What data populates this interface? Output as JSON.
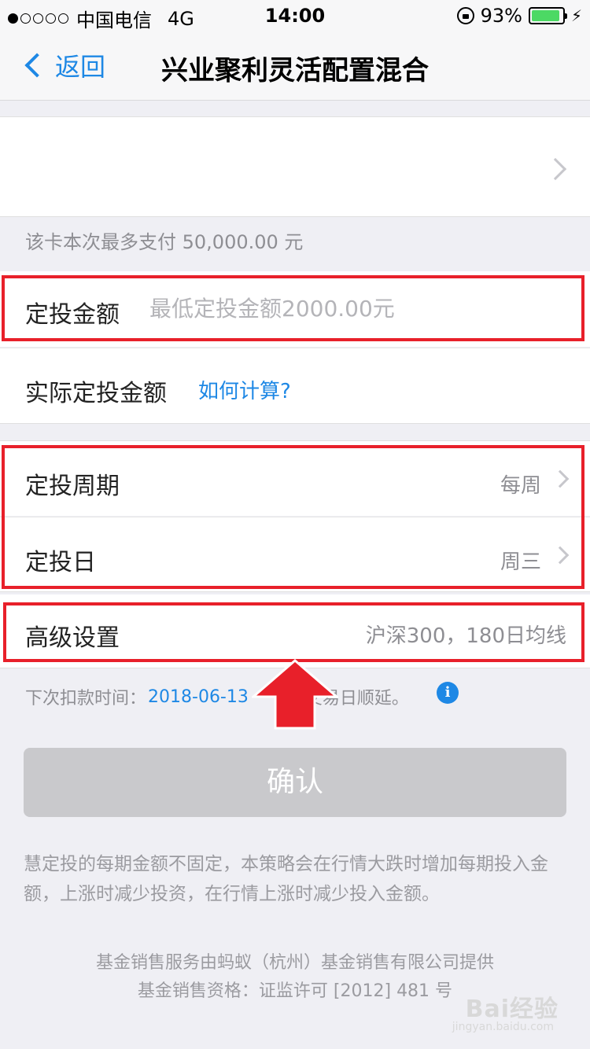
{
  "status_bar": {
    "carrier": "中国电信",
    "network": "4G",
    "time": "14:00",
    "battery_percent": "93%",
    "battery_level": 0.93
  },
  "nav": {
    "back_label": "返回",
    "title": "兴业聚利灵活配置混合"
  },
  "payment": {
    "limit_note": "该卡本次最多支付 50,000.00 元"
  },
  "form": {
    "amount_label": "定投金额",
    "amount_placeholder": "最低定投金额2000.00元",
    "actual_label": "实际定投金额",
    "how_link": "如何计算?",
    "period_label": "定投周期",
    "period_value": "每周",
    "day_label": "定投日",
    "day_value": "周三",
    "advanced_label": "高级设置",
    "advanced_value": "沪深300，180日均线"
  },
  "next_deduction": {
    "prefix": "下次扣款时间：",
    "date": "2018-06-13",
    "suffix": "交易日顺延。"
  },
  "confirm_label": "确认",
  "description": "慧定投的每期金额不固定，本策略会在行情大跌时增加每期投入金额，上涨时减少投资，在行情上涨时减少投入金额。",
  "footer": {
    "line1": "基金销售服务由蚂蚁（杭州）基金销售有限公司提供",
    "line2": "基金销售资格：证监许可 [2012] 481 号"
  },
  "watermark": {
    "brand": "Bai经验",
    "url": "jingyan.baidu.com"
  },
  "colors": {
    "accent": "#1e88e5",
    "highlight": "#e8202a",
    "battery": "#4cd964"
  }
}
